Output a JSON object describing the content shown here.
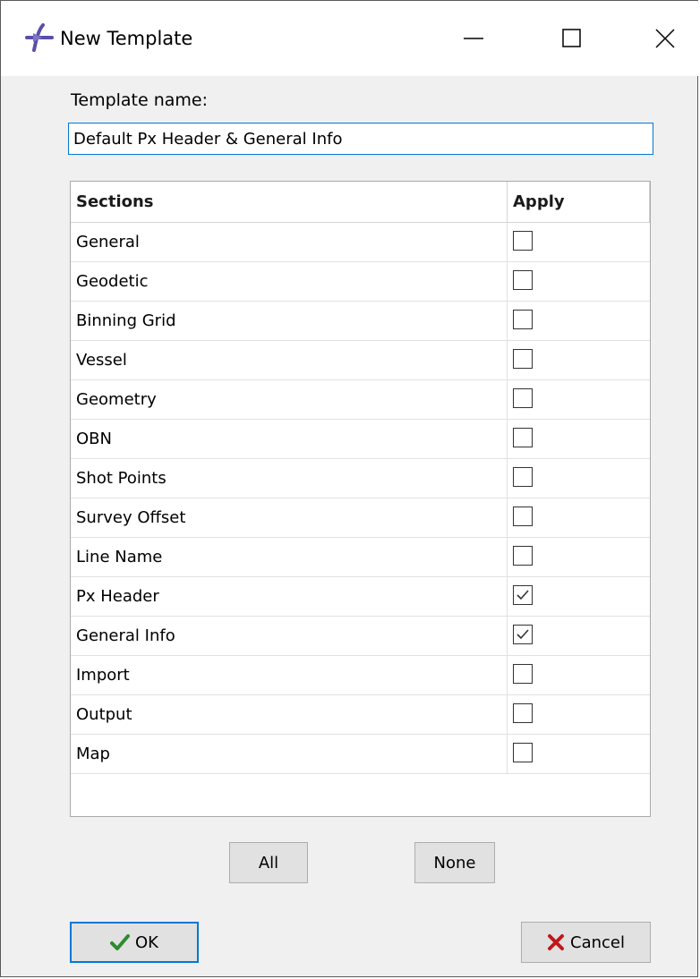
{
  "window": {
    "title": "New Template",
    "icon": "app-logo-icon"
  },
  "titlebar_buttons": {
    "minimize": "minimize-icon",
    "maximize": "maximize-icon",
    "close": "close-icon"
  },
  "form": {
    "label": "Template name:",
    "value": "Default Px Header & General Info"
  },
  "table": {
    "headers": {
      "sections": "Sections",
      "apply": "Apply"
    },
    "rows": [
      {
        "label": "General",
        "checked": false
      },
      {
        "label": "Geodetic",
        "checked": false
      },
      {
        "label": "Binning Grid",
        "checked": false
      },
      {
        "label": "Vessel",
        "checked": false
      },
      {
        "label": "Geometry",
        "checked": false
      },
      {
        "label": "OBN",
        "checked": false
      },
      {
        "label": "Shot Points",
        "checked": false
      },
      {
        "label": "Survey Offset",
        "checked": false
      },
      {
        "label": "Line Name",
        "checked": false
      },
      {
        "label": "Px Header",
        "checked": true
      },
      {
        "label": "General Info",
        "checked": true
      },
      {
        "label": "Import",
        "checked": false
      },
      {
        "label": "Output",
        "checked": false
      },
      {
        "label": "Map",
        "checked": false
      }
    ]
  },
  "buttons": {
    "all": "All",
    "none": "None",
    "ok": "OK",
    "cancel": "Cancel"
  },
  "colors": {
    "accent": "#0078d7",
    "ok_check": "#2e8b2e",
    "cancel_x": "#c0181c",
    "logo": "#5a4fa8"
  }
}
